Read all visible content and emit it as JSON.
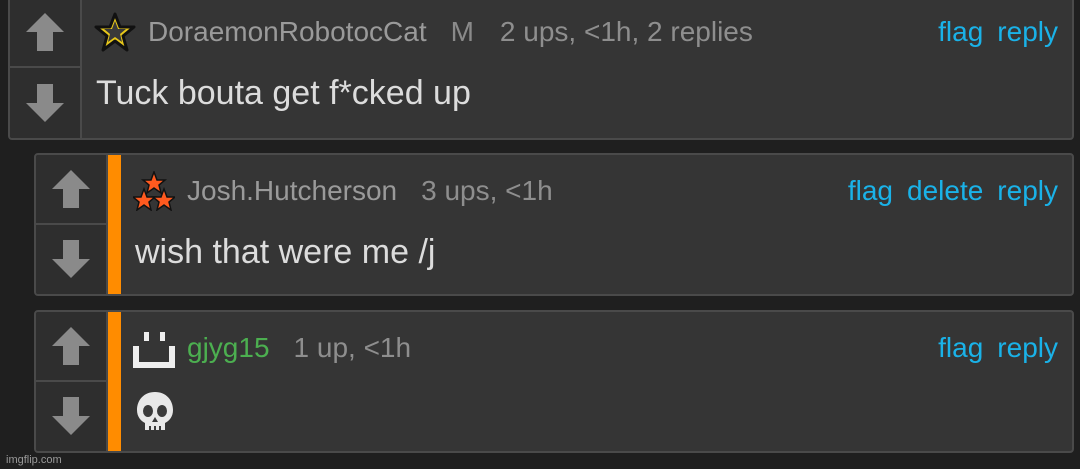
{
  "comments": [
    {
      "avatar": "star-outline-icon",
      "username": "DoraemonRobotocCat",
      "badge": "M",
      "meta": "2 ups, <1h, 2 replies",
      "actions": [
        "flag",
        "reply"
      ],
      "text": "Tuck bouta get f*cked up"
    },
    {
      "avatar": "three-stars-icon",
      "username": "Josh.Hutcherson",
      "meta": "3 ups, <1h",
      "actions": [
        "flag",
        "delete",
        "reply"
      ],
      "text": "wish that were me /j"
    },
    {
      "avatar": "pixel-face-icon",
      "username": "gjyg15",
      "username_color": "#4caf50",
      "meta": "1 up, <1h",
      "actions": [
        "flag",
        "reply"
      ],
      "text_icon": "skull-icon"
    }
  ],
  "colors": {
    "accent": "#ff8c00",
    "link": "#1ab2e8",
    "background": "#1f1f1f",
    "panel": "#353535"
  },
  "watermark": "imgflip.com"
}
